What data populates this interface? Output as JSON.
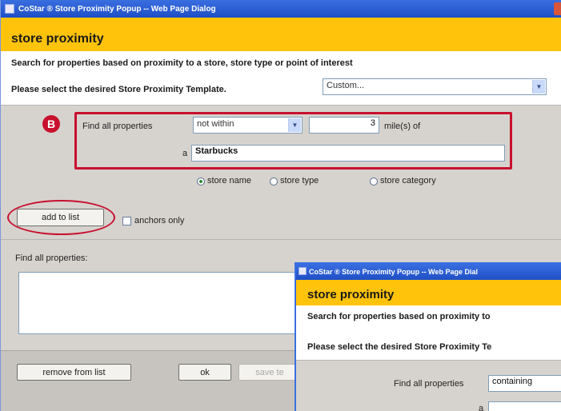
{
  "window": {
    "title": "CoStar ® Store Proximity Popup -- Web Page Dialog",
    "heading": "store proximity",
    "intro": "Search for properties based on proximity to a store, store type or point of interest",
    "template_label": "Please select the desired Store Proximity Template.",
    "template_value": "Custom..."
  },
  "criteria": {
    "marker": "B",
    "find_label": "Find all properties",
    "relation_value": "not within",
    "distance_value": "3",
    "units_label": "mile(s) of",
    "a_label": "a",
    "store_value": "Starbucks"
  },
  "search_by": {
    "options": [
      "store name",
      "store type",
      "store category"
    ],
    "selected": "store name"
  },
  "actions": {
    "add_to_list": "add to list",
    "anchors_only": "anchors only"
  },
  "list": {
    "label": "Find all properties:"
  },
  "bottom": {
    "remove_from_list": "remove from list",
    "ok": "ok",
    "save_partial": "save te"
  },
  "overlay_window": {
    "title": "CoStar ® Store Proximity Popup -- Web Page Dial",
    "heading": "store proximity",
    "intro": "Search for properties based on proximity to",
    "template_label": "Please select the desired Store Proximity Te",
    "find_label": "Find all properties",
    "relation_value": "containing",
    "a_label": "a"
  },
  "colors": {
    "titlebar": "#2a5fd8",
    "header_band": "#ffc30b",
    "annotation_red": "#c8102e",
    "dialog_grey": "#d6d3ce"
  }
}
